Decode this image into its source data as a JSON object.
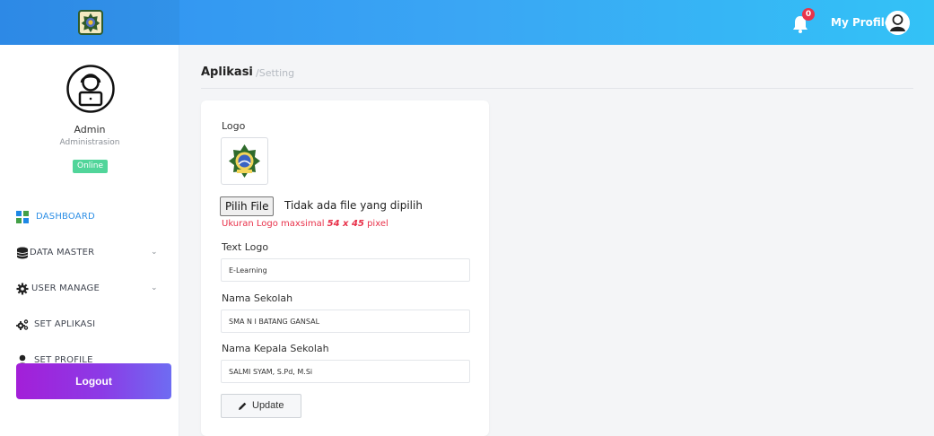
{
  "topbar": {
    "notification_count": "0",
    "profile_label": "My Profile"
  },
  "sidebar": {
    "user_name": "Admin",
    "user_role": "Administrasion",
    "status": "Online",
    "menu": [
      {
        "label": "DASHBOARD",
        "icon": "dashboard-icon",
        "active": true
      },
      {
        "label": "DATA MASTER",
        "icon": "database-icon",
        "has_submenu": true
      },
      {
        "label": "USER MANAGE",
        "icon": "gear-icon",
        "has_submenu": true
      },
      {
        "label": "SET APLIKASI",
        "icon": "gears-icon"
      },
      {
        "label": "SET PROFILE",
        "icon": "user-icon"
      }
    ],
    "logout_label": "Logout"
  },
  "page": {
    "title": "Aplikasi",
    "breadcrumb": "/Setting"
  },
  "form": {
    "logo_label": "Logo",
    "file_button": "Pilih File",
    "file_status": "Tidak ada file yang dipilih",
    "hint_prefix": "Ukuran Logo maxsimal ",
    "hint_size": "54 x 45",
    "hint_suffix": " pixel",
    "text_logo_label": "Text Logo",
    "text_logo_value": "E-Learning",
    "school_name_label": "Nama Sekolah",
    "school_name_value": "SMA N I BATANG GANSAL",
    "principal_label": "Nama Kepala Sekolah",
    "principal_value": "SALMI SYAM, S.Pd, M.Si",
    "update_label": "Update"
  },
  "colors": {
    "topbar_start": "#2f8ff0",
    "topbar_end": "#33c2f6",
    "active_menu": "#2d8fe6",
    "online": "#51d59a",
    "hint": "#e8314a",
    "logout_start": "#a31fd8",
    "logout_end": "#6e6cf2"
  }
}
